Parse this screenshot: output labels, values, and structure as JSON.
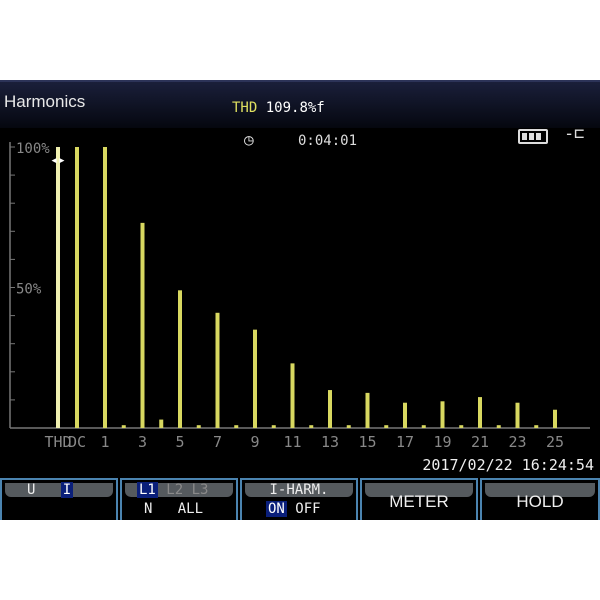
{
  "header": {
    "title": "Harmonics",
    "thd_label": "THD",
    "thd_value": "109.8%f",
    "timer": "0:04:01",
    "icons": [
      "timer-icon",
      "battery-icon",
      "plug-icon",
      "cursor-icon"
    ]
  },
  "datetime": "2017/02/22  16:24:54",
  "function_keys": [
    {
      "options": [
        "U",
        "I"
      ],
      "selected": "I"
    },
    {
      "options": [
        "L1",
        "L2",
        "L3"
      ],
      "options2": [
        "N",
        "ALL"
      ],
      "selected": "L1"
    },
    {
      "label": "I-HARM.",
      "options": [
        "ON",
        "OFF"
      ],
      "selected": "ON"
    },
    {
      "label": "METER"
    },
    {
      "label": "HOLD"
    }
  ],
  "colors": {
    "bar": "#d8d860",
    "thd_bar": "#f0f0b0",
    "accent_border": "#4b84b0",
    "selected": "#0a1f7a"
  },
  "chart_data": {
    "type": "bar",
    "ylabel_ticks": [
      "100%",
      "50%"
    ],
    "ylim": [
      0,
      100
    ],
    "categories": [
      "THD",
      "DC",
      "1",
      "2",
      "3",
      "4",
      "5",
      "6",
      "7",
      "8",
      "9",
      "10",
      "11",
      "12",
      "13",
      "14",
      "15",
      "16",
      "17",
      "18",
      "19",
      "20",
      "21",
      "22",
      "23",
      "24",
      "25"
    ],
    "xtick_labels": [
      "THD",
      "DC",
      "1",
      "3",
      "5",
      "7",
      "9",
      "11",
      "13",
      "15",
      "17",
      "19",
      "21",
      "23",
      "25"
    ],
    "values": [
      100,
      100,
      100,
      1,
      73,
      3,
      49,
      1,
      41,
      1,
      35,
      1,
      23,
      1,
      13.5,
      1,
      12.5,
      1,
      9,
      1,
      9.5,
      1,
      11,
      1,
      9,
      1,
      6.5
    ],
    "grid": false
  }
}
